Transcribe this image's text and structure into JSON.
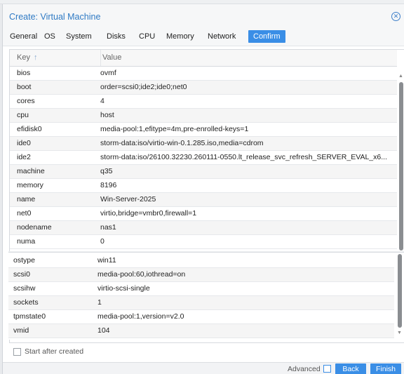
{
  "dialog": {
    "title": "Create: Virtual Machine",
    "close_icon": "close-circle-icon"
  },
  "tabs": [
    {
      "label": "General"
    },
    {
      "label": "OS"
    },
    {
      "label": "System"
    },
    {
      "label": "Disks"
    },
    {
      "label": "CPU"
    },
    {
      "label": "Memory"
    },
    {
      "label": "Network"
    },
    {
      "label": "Confirm",
      "active": true
    }
  ],
  "grid": {
    "headers": {
      "key": "Key",
      "value": "Value",
      "sort_icon": "sort-ascending-icon"
    },
    "rows": [
      {
        "key": "bios",
        "value": "ovmf"
      },
      {
        "key": "boot",
        "value": "order=scsi0;ide2;ide0;net0"
      },
      {
        "key": "cores",
        "value": "4"
      },
      {
        "key": "cpu",
        "value": "host"
      },
      {
        "key": "efidisk0",
        "value": "media-pool:1,efitype=4m,pre-enrolled-keys=1"
      },
      {
        "key": "ide0",
        "value": "storm-data:iso/virtio-win-0.1.285.iso,media=cdrom"
      },
      {
        "key": "ide2",
        "value": "storm-data:iso/26100.32230.260111-0550.lt_release_svc_refresh_SERVER_EVAL_x6..."
      },
      {
        "key": "machine",
        "value": "q35"
      },
      {
        "key": "memory",
        "value": "8196"
      },
      {
        "key": "name",
        "value": "Win-Server-2025"
      },
      {
        "key": "net0",
        "value": "virtio,bridge=vmbr0,firewall=1"
      },
      {
        "key": "nodename",
        "value": "nas1"
      },
      {
        "key": "numa",
        "value": "0"
      }
    ],
    "lower_rows": [
      {
        "key": "ostype",
        "value": "win11"
      },
      {
        "key": "scsi0",
        "value": "media-pool:60,iothread=on"
      },
      {
        "key": "scsihw",
        "value": "virtio-scsi-single"
      },
      {
        "key": "sockets",
        "value": "1"
      },
      {
        "key": "tpmstate0",
        "value": "media-pool:1,version=v2.0"
      },
      {
        "key": "vmid",
        "value": "104"
      }
    ]
  },
  "options": {
    "start_after_created": "Start after created"
  },
  "footer": {
    "advanced_label": "Advanced",
    "back_label": "Back",
    "finish_label": "Finish"
  },
  "colors": {
    "accent": "#3a8ee6",
    "title": "#2f7ac4"
  }
}
